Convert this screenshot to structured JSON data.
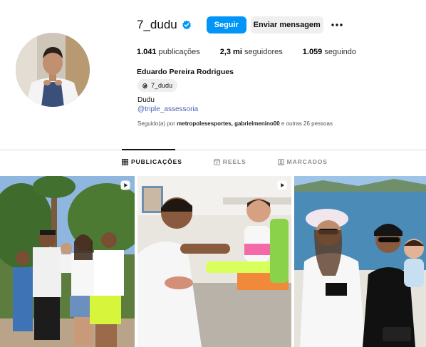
{
  "profile": {
    "username": "7_dudu",
    "verified": true,
    "follow_label": "Seguir",
    "message_label": "Enviar mensagem",
    "more_icon": "more-horizontal-icon",
    "stats": {
      "posts_count": "1.041",
      "posts_label": "publicações",
      "followers_count": "2,3 mi",
      "followers_label": "seguidores",
      "following_count": "1.059",
      "following_label": "seguindo"
    },
    "full_name": "Eduardo Pereira Rodrigues",
    "threads_handle": "7_dudu",
    "bio": "Dudu",
    "bio_link": "@triple_assessoria",
    "followed_by_prefix": "Seguido(a) por",
    "followed_by_names": "metropolesesportes, gabrielmenino00",
    "followed_by_suffix": "e outras 26 pessoas"
  },
  "tabs": [
    {
      "label": "PUBLICAÇÕES",
      "icon": "grid-icon",
      "active": true
    },
    {
      "label": "REELS",
      "icon": "reels-icon",
      "active": false
    },
    {
      "label": "MARCADOS",
      "icon": "tagged-icon",
      "active": false
    }
  ],
  "colors": {
    "accent": "#0095f6",
    "link": "#4a5db6",
    "verified": "#0095f6",
    "secondary_button": "#efefef"
  },
  "posts": [
    {
      "kind": "reel"
    },
    {
      "kind": "reel"
    },
    {
      "kind": "photo"
    }
  ]
}
